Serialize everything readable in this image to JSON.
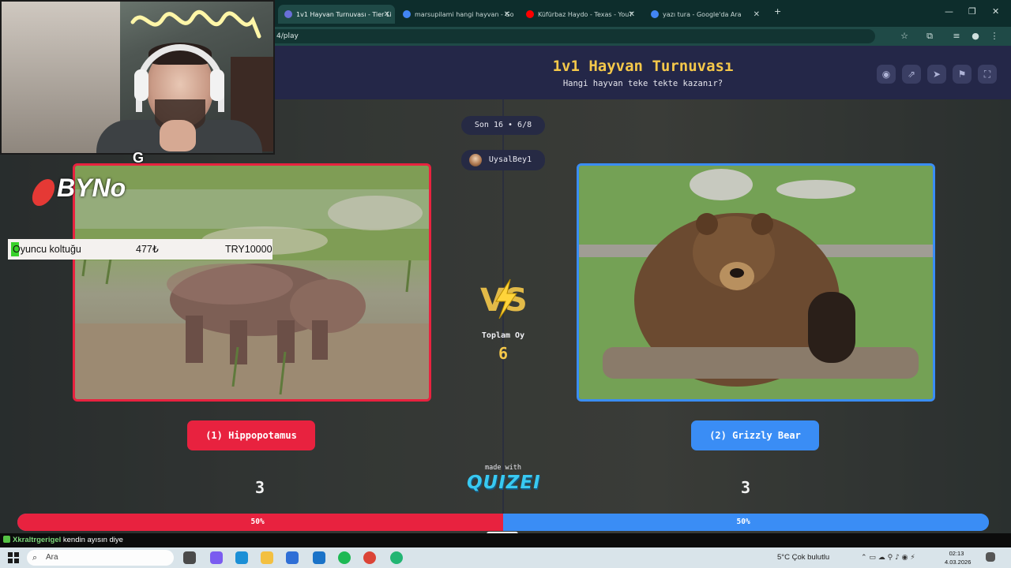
{
  "browser": {
    "tabs": [
      {
        "label": "1v1 Hayvan Turnuvası - Tier Li",
        "active": true,
        "favicon_color": "#6a6fd8"
      },
      {
        "label": "marsupilami hangi hayvan - Go",
        "active": false,
        "favicon_color": "#4285f4"
      },
      {
        "label": "Küfürbaz Haydo - Texas - YouT",
        "active": false,
        "favicon_color": "#ff0000"
      },
      {
        "label": "yazı tura - Google'da Ara",
        "active": false,
        "favicon_color": "#4285f4"
      }
    ],
    "url": "4/play"
  },
  "page": {
    "title": "1v1 Hayvan Turnuvası",
    "subtitle": "Hangi hayvan teke tekte kazanır?",
    "round": "Son 16 • 6/8",
    "user": "UysalBey1",
    "total_label": "Toplam Oy",
    "total_votes": "6",
    "left": {
      "label": "(1) Hippopotamus",
      "votes": "3",
      "percent_text": "50%",
      "share": 0.5,
      "color": "#e8223f"
    },
    "right": {
      "label": "(2) Grizzly Bear",
      "votes": "3",
      "percent_text": "50%",
      "share": 0.5,
      "color": "#3a8df5"
    },
    "made_with": "made with",
    "brand": "QUIZEI"
  },
  "overlay": {
    "logo_main": "BYNo",
    "logo_accent": "G",
    "ticker": {
      "name": "Oyuncu koltuğu",
      "price": "477₺",
      "goal": "TRY10000"
    },
    "chat": {
      "user": "Xkraltrgerigel",
      "message": "kendin ayısın diye"
    }
  },
  "taskbar": {
    "search_placeholder": "Ara",
    "weather": "5°C  Çok bulutlu",
    "time": "02:13",
    "date": "4.03.2026"
  }
}
